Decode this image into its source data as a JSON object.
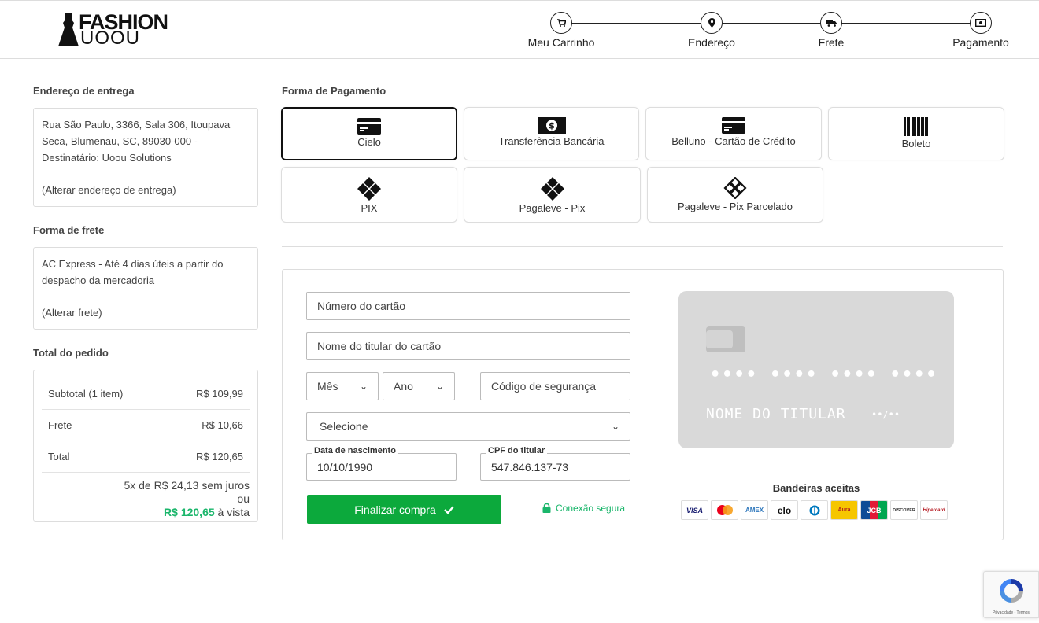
{
  "header": {
    "logo_top": "FASHION",
    "logo_bottom": "UOOU",
    "steps": [
      {
        "label": "Meu Carrinho",
        "icon": "cart-icon"
      },
      {
        "label": "Endereço",
        "icon": "map-pin-icon"
      },
      {
        "label": "Frete",
        "icon": "truck-icon"
      },
      {
        "label": "Pagamento",
        "icon": "money-icon"
      }
    ]
  },
  "address": {
    "title": "Endereço de entrega",
    "text": "Rua São Paulo, 3366, Sala 306, Itoupava Seca, Blumenau, SC, 89030-000 - Destinatário: Uoou Solutions",
    "change_link": "(Alterar endereço de entrega)"
  },
  "shipping": {
    "title": "Forma de frete",
    "text": "AC Express - Até 4 dias úteis a partir do despacho da mercadoria",
    "change_link": "(Alterar frete)"
  },
  "order_total": {
    "title": "Total do pedido",
    "rows": [
      {
        "label": "Subtotal (1 item)",
        "value": "R$ 109,99"
      },
      {
        "label": "Frete",
        "value": "R$ 10,66"
      },
      {
        "label": "Total",
        "value": "R$ 120,65"
      }
    ],
    "installments_line1": "5x de R$ 24,13 sem juros",
    "installments_line2": "ou",
    "cash_price": "R$ 120,65",
    "cash_suffix": " à vista"
  },
  "payment": {
    "title": "Forma de Pagamento",
    "methods": [
      {
        "name": "Cielo",
        "icon": "credit-card-icon",
        "selected": true
      },
      {
        "name": "Transferência Bancária",
        "icon": "money-bill-icon",
        "selected": false
      },
      {
        "name": "Belluno - Cartão de Crédito",
        "icon": "credit-card-icon",
        "selected": false
      },
      {
        "name": "Boleto",
        "icon": "barcode-icon",
        "selected": false
      },
      {
        "name": "PIX",
        "icon": "pix-icon",
        "selected": false
      },
      {
        "name": "Pagaleve - Pix",
        "icon": "pix-icon",
        "selected": false
      },
      {
        "name": "Pagaleve - Pix Parcelado",
        "icon": "pix-installment-icon",
        "selected": false
      }
    ]
  },
  "form": {
    "card_number_placeholder": "Número do cartão",
    "card_name_placeholder": "Nome do titular do cartão",
    "month_placeholder": "Mês",
    "year_placeholder": "Ano",
    "cvv_placeholder": "Código de segurança",
    "installments_select": "Selecione",
    "birth_label": "Data de nascimento",
    "birth_value": "10/10/1990",
    "cpf_label": "CPF do titular",
    "cpf_value": "547.846.137-73",
    "finish_button": "Finalizar compra",
    "secure_text": "Conexão segura"
  },
  "card_preview": {
    "number": "•••• •••• •••• ••••",
    "holder": "NOME DO TITULAR",
    "expiry": "••/••"
  },
  "brands": {
    "title": "Bandeiras aceitas",
    "items": [
      "VISA",
      "Mastercard",
      "AMEX",
      "elo",
      "Diners",
      "Aura",
      "JCB",
      "DISCOVER",
      "Hipercard"
    ]
  },
  "recaptcha": {
    "links": "Privacidade - Termos"
  },
  "colors": {
    "accent_green": "#0ca93c",
    "price_green": "#1ab66b"
  }
}
